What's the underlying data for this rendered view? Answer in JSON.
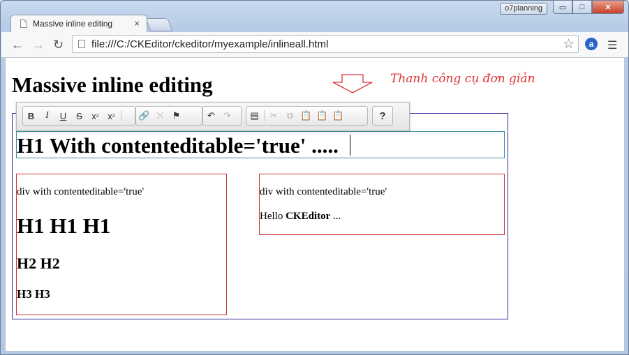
{
  "window": {
    "profile_label": "o7planning",
    "controls": {
      "minimize": "▭",
      "maximize": "□",
      "close": "✕"
    }
  },
  "tab": {
    "title": "Massive inline editing",
    "close": "×"
  },
  "toolbar": {
    "url": "file:///C:/CKEditor/ckeditor/myexample/inlineall.html",
    "extension_letter": "a"
  },
  "page": {
    "heading": "Massive inline editing",
    "annotation": "Thanh công cụ đơn giản",
    "annotation_color": "#dd3333",
    "h1_editable": "H1 With contenteditable='true' .....",
    "left_box": {
      "label": "div with contenteditable='true'",
      "h1": "H1 H1 H1",
      "h2": "H2 H2",
      "h3": "H3 H3"
    },
    "right_box": {
      "label": "div with contenteditable='true'",
      "hello": "Hello ",
      "bold": "CKEditor",
      "rest": " ..."
    }
  },
  "ckeditor_toolbar": {
    "buttons": [
      "bold-icon",
      "italic-icon",
      "underline-icon",
      "strike-icon",
      "subscript-icon",
      "superscript-icon",
      "link-icon",
      "unlink-icon",
      "anchor-icon",
      "undo-icon",
      "redo-icon",
      "source-icon",
      "cut-icon",
      "copy-icon",
      "paste-icon",
      "paste-text-icon",
      "paste-word-icon",
      "help-icon"
    ],
    "labels": {
      "bold": "B",
      "italic": "I",
      "underline": "U",
      "strike": "S",
      "help": "?"
    }
  }
}
